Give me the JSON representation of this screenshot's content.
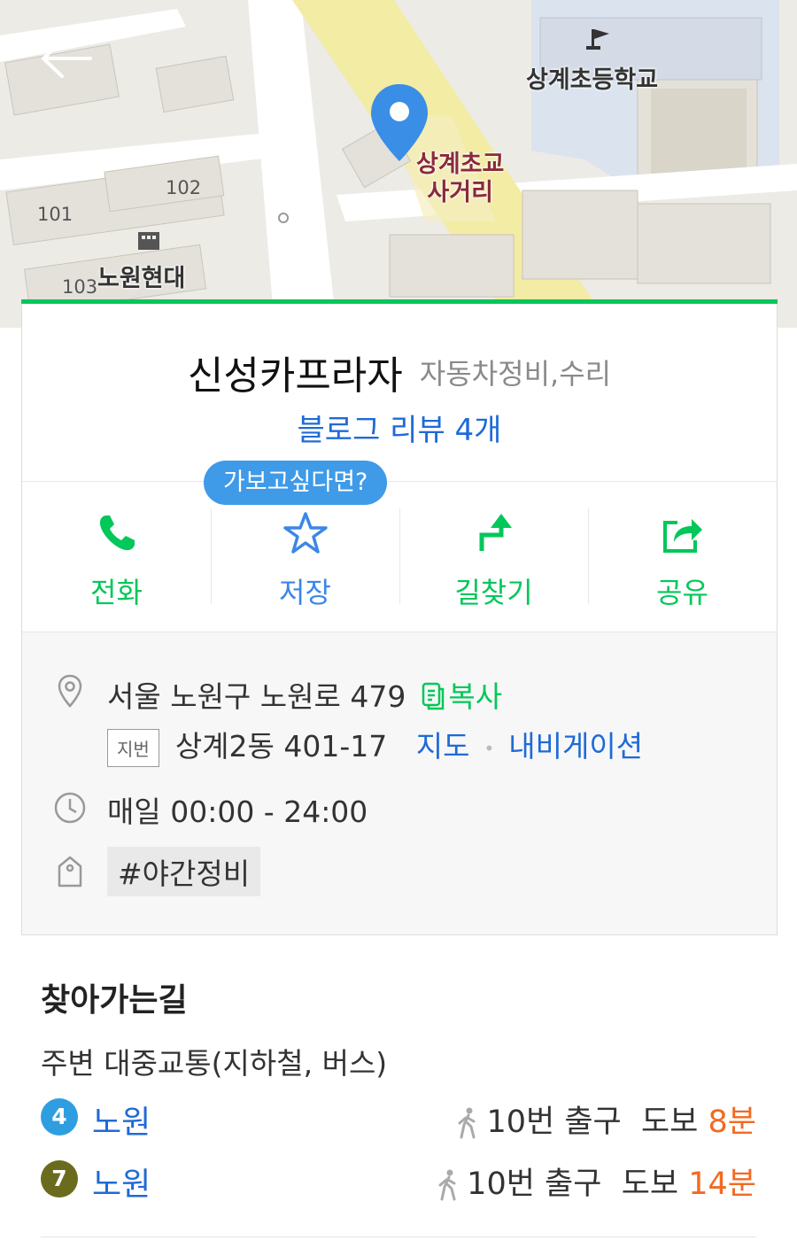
{
  "map": {
    "labels": {
      "school": "상계초등학교",
      "intersection_line1": "상계초교",
      "intersection_line2": "사거리",
      "apartment_line1": "노원현대",
      "building_101": "101",
      "building_102": "102",
      "building_103": "103"
    }
  },
  "place": {
    "name": "신성카프라자",
    "category": "자동차정비,수리",
    "review_link": "블로그 리뷰 4개",
    "tooltip": "가보고싶다면?"
  },
  "actions": [
    {
      "label": "전화",
      "icon": "phone-icon"
    },
    {
      "label": "저장",
      "icon": "star-icon"
    },
    {
      "label": "길찾기",
      "icon": "directions-arrow-icon"
    },
    {
      "label": "공유",
      "icon": "share-icon"
    }
  ],
  "info": {
    "address": "서울 노원구 노원로 479",
    "copy_label": "복사",
    "jibun_badge": "지번",
    "jibun_address": "상계2동 401-17",
    "map_link": "지도",
    "nav_link": "내비게이션",
    "hours": "매일 00:00 - 24:00",
    "tag": "#야간정비"
  },
  "directions": {
    "title": "찾아가는길",
    "subtitle": "주변 대중교통(지하철, 버스)",
    "rows": [
      {
        "line": "4",
        "color": "#2e9ee0",
        "station": "노원",
        "exit": "10번 출구",
        "walk_label": "도보",
        "minutes": "8분"
      },
      {
        "line": "7",
        "color": "#6b6b1e",
        "station": "노원",
        "exit": "10번 출구",
        "walk_label": "도보",
        "minutes": "14분"
      }
    ]
  },
  "colors": {
    "brand_green": "#03c75a",
    "link_blue": "#1f6ad6",
    "accent_orange": "#f26a22"
  }
}
